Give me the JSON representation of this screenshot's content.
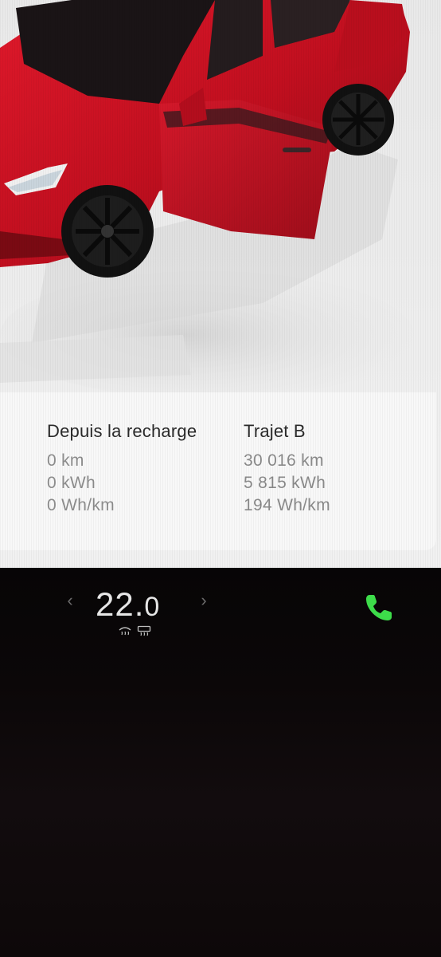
{
  "car": {
    "color": "#c8101e"
  },
  "trip": {
    "since_charge": {
      "title": "Depuis la recharge",
      "distance": "0 km",
      "energy": "0 kWh",
      "efficiency": "0 Wh/km"
    },
    "trip_b": {
      "title": "Trajet B",
      "distance": "30 016 km",
      "energy": "5 815 kWh",
      "efficiency": "194 Wh/km"
    }
  },
  "climate": {
    "temperature_int": "22.",
    "temperature_dec": "0",
    "left_chevron_icon": "chevron-left-icon",
    "right_chevron_icon": "chevron-right-icon",
    "front_defrost_icon": "front-defrost-icon",
    "rear_defrost_icon": "rear-defrost-icon"
  },
  "phone": {
    "icon": "phone-icon",
    "color": "#3ddc4a"
  }
}
